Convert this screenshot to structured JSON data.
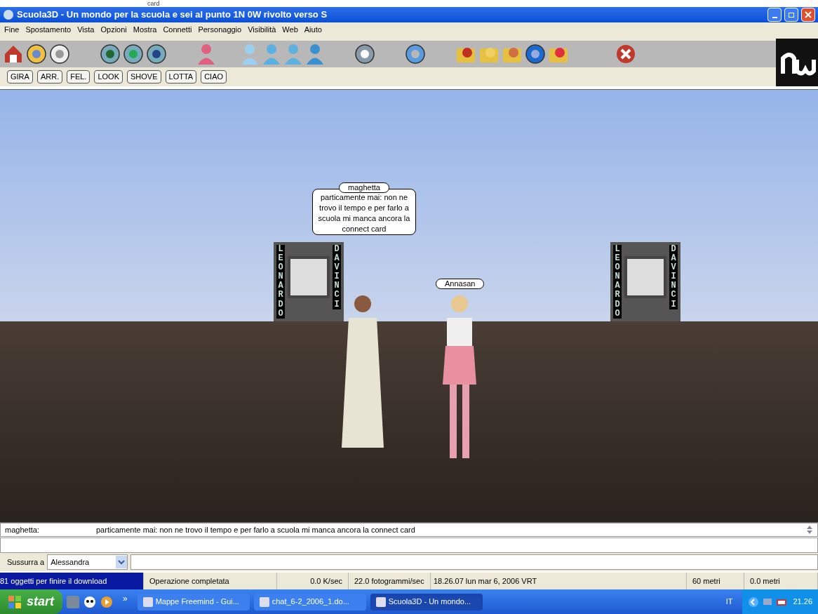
{
  "stray_text": "card",
  "window": {
    "title": "Scuola3D - Un mondo per la scuola e sei al punto 1N 0W rivolto verso S"
  },
  "menu": [
    "Fine",
    "Spostamento",
    "Vista",
    "Opzioni",
    "Mostra",
    "Connetti",
    "Personaggio",
    "Visibilità",
    "Web",
    "Aiuto"
  ],
  "gestures": [
    "GIRA",
    "ARR.",
    "FEL.",
    "LOOK",
    "SHOVE",
    "LOTTA",
    "CIAO"
  ],
  "scene": {
    "bubble": {
      "name": "maghetta",
      "text": "particamente mai: non ne trovo il tempo e per farlo a scuola mi manca ancora la connect card"
    },
    "name_tag": "Annasan",
    "signs": [
      {
        "left": "LEONARDO",
        "right": "DA VINCI"
      },
      {
        "left": "LEONARDO",
        "right": "DA VINCI"
      }
    ]
  },
  "chat_log": [
    {
      "speaker": "maghetta:",
      "message": "particamente mai: non ne trovo il tempo e per farlo a scuola mi manca ancora la connect card"
    }
  ],
  "whisper": {
    "label": "Sussurra a",
    "recipient": "Alessandra"
  },
  "status_bar": [
    "81 oggetti per finire il download",
    "Operazione completata",
    "0.0 K/sec",
    "22.0 fotogrammi/sec",
    "18.26.07 lun mar 6, 2006 VRT",
    "60 metri",
    "0.0 metri"
  ],
  "taskbar": {
    "start": "start",
    "overflow": "»",
    "tasks": [
      {
        "label": "Mappe Freemind - Gui...",
        "selected": false
      },
      {
        "label": "chat_6-2_2006_1.do...",
        "selected": false
      },
      {
        "label": "Scuola3D - Un mondo...",
        "selected": true
      }
    ],
    "language": "IT",
    "clock": "21.26"
  }
}
